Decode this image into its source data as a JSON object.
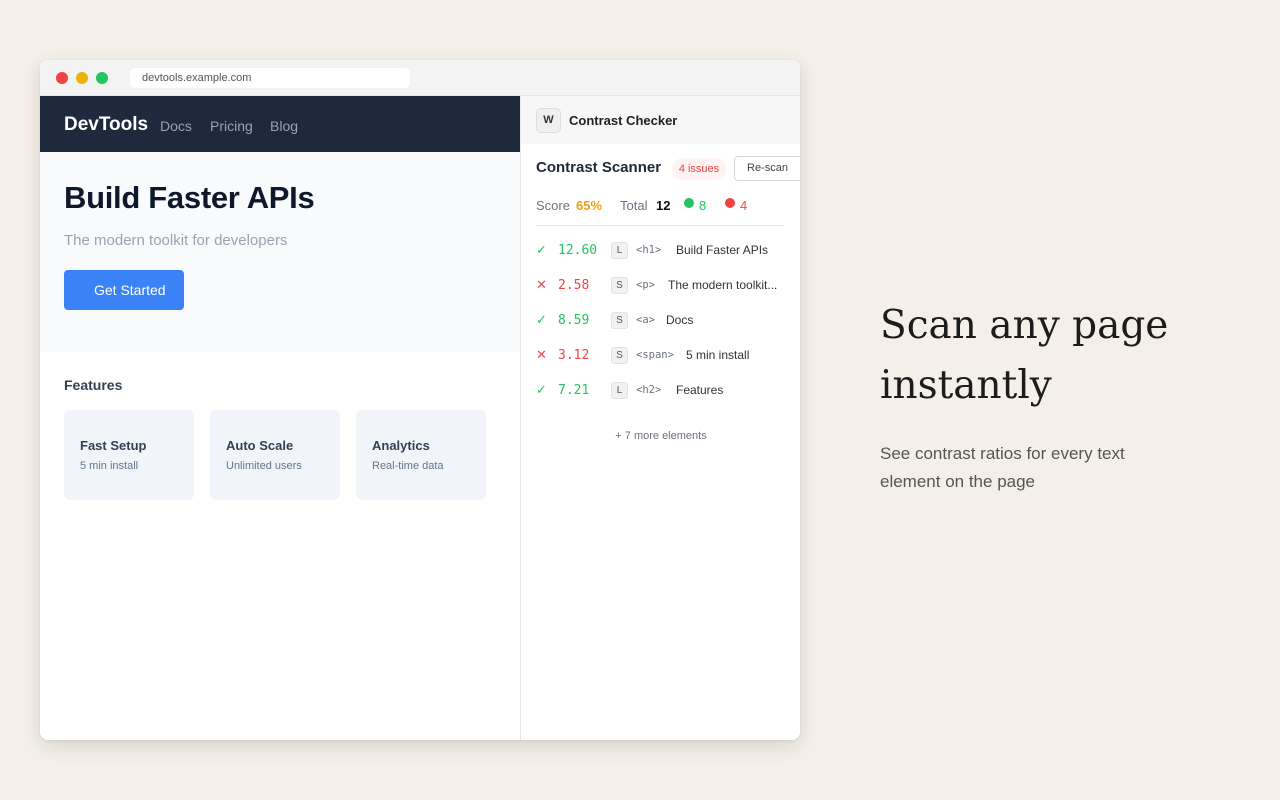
{
  "browser": {
    "url": "devtools.example.com"
  },
  "site": {
    "brand": "DevTools",
    "nav": [
      "Docs",
      "Pricing",
      "Blog"
    ],
    "hero": {
      "title": "Build Faster APIs",
      "subtitle": "The modern toolkit for developers",
      "cta": "Get Started"
    },
    "features": {
      "title": "Features",
      "cards": [
        {
          "title": "Fast Setup",
          "sub": "5 min install"
        },
        {
          "title": "Auto Scale",
          "sub": "Unlimited users"
        },
        {
          "title": "Analytics",
          "sub": "Real-time data"
        }
      ]
    }
  },
  "extension": {
    "icon_letter": "W",
    "name": "Contrast Checker",
    "scanner_title": "Contrast Scanner",
    "issues_badge": "4 issues",
    "rescan_label": "Re-scan",
    "stats": {
      "score_label": "Score",
      "score_value": "65%",
      "total_label": "Total",
      "total_value": "12",
      "pass_count": "8",
      "fail_count": "4"
    },
    "results": [
      {
        "mark": "✓",
        "ratio": "12.60",
        "size": "L",
        "tag": "<h1>",
        "text": "Build Faster APIs",
        "status": "pass"
      },
      {
        "mark": "✕",
        "ratio": "2.58",
        "size": "S",
        "tag": "<p>",
        "text": "The modern toolkit...",
        "status": "fail"
      },
      {
        "mark": "✓",
        "ratio": "8.59",
        "size": "S",
        "tag": "<a>",
        "text": "Docs",
        "status": "pass"
      },
      {
        "mark": "✕",
        "ratio": "3.12",
        "size": "S",
        "tag": "<span>",
        "text": "5 min install",
        "status": "fail"
      },
      {
        "mark": "✓",
        "ratio": "7.21",
        "size": "L",
        "tag": "<h2>",
        "text": "Features",
        "status": "pass"
      }
    ],
    "more": "+ 7 more elements"
  },
  "marketing": {
    "tagline": "Scan any page instantly",
    "description": "See contrast ratios for every text element on the page"
  },
  "colors": {
    "pass": "#22c55e",
    "fail": "#ef4444",
    "score": "#f59e0b",
    "accent": "#3b82f6",
    "nav_bg": "#1e293b"
  }
}
